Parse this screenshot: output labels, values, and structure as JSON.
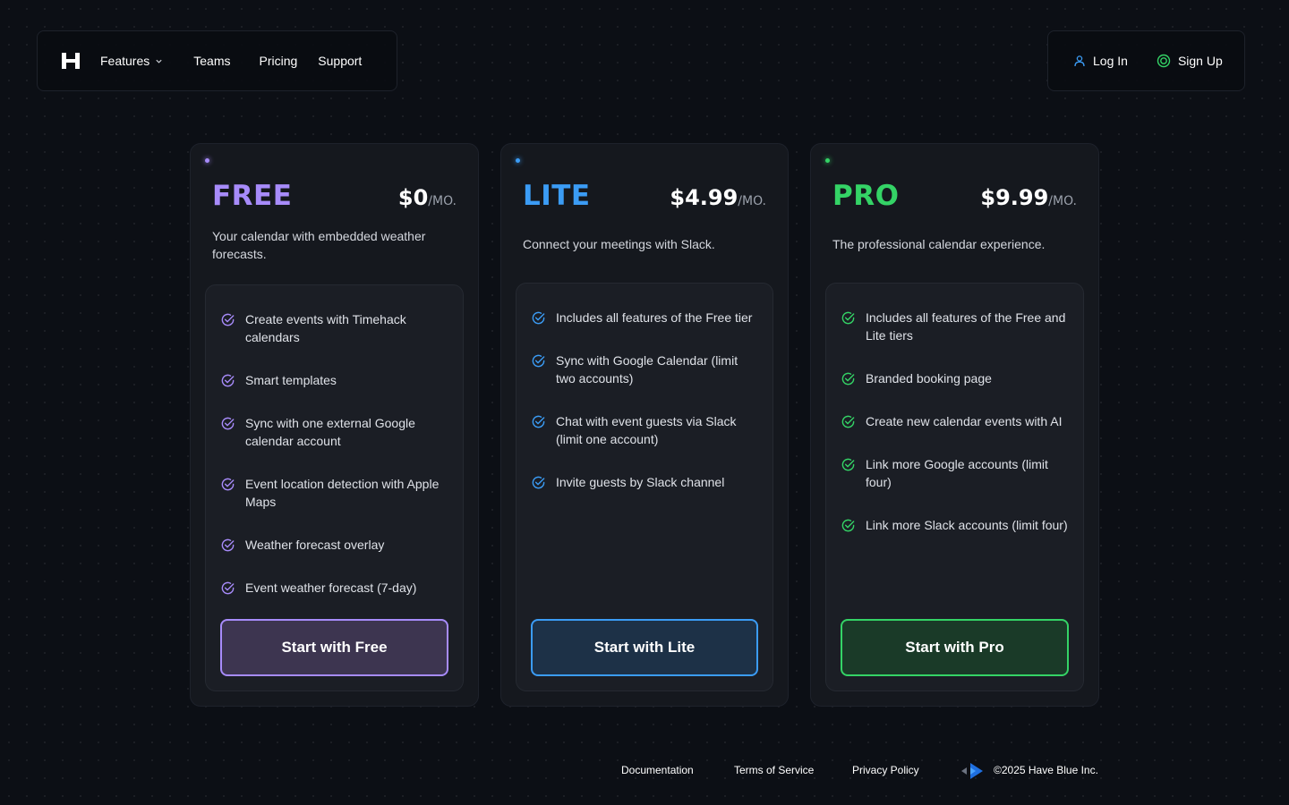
{
  "nav": {
    "logo": "logo-icon",
    "links": [
      {
        "label": "Features",
        "icon": "chevron-down-icon"
      },
      {
        "label": "Teams"
      },
      {
        "label": "Pricing"
      },
      {
        "label": "Support"
      }
    ],
    "login_label": "Log In",
    "login_icon": "user-icon",
    "signup_label": "Sign Up",
    "signup_icon": "smile-icon"
  },
  "plans": [
    {
      "name": "FREE",
      "price": "$0",
      "unit": "/MO.",
      "accent": "#a78bfa",
      "description": "Your calendar with embedded weather forecasts.",
      "features": [
        "Create events with Timehack calendars",
        "Smart templates",
        "Sync with one external Google calendar account",
        "Event location detection with Apple Maps",
        "Weather forecast overlay",
        "Event weather forecast (7-day)"
      ],
      "cta": "Start with Free"
    },
    {
      "name": "LITE",
      "price": "$4.99",
      "unit": "/MO.",
      "accent": "#3b9cf5",
      "description": "Connect your meetings with Slack.",
      "features": [
        "Includes all features of the Free tier",
        "Sync with Google Calendar (limit two accounts)",
        "Chat with event guests via Slack (limit one account)",
        "Invite guests by Slack channel"
      ],
      "cta": "Start with Lite"
    },
    {
      "name": "PRO",
      "price": "$9.99",
      "unit": "/MO.",
      "accent": "#34d366",
      "description": "The professional calendar experience.",
      "features": [
        "Includes all features of the Free and Lite tiers",
        "Branded booking page",
        "Create new calendar events with AI",
        "Link more Google accounts (limit four)",
        "Link more Slack accounts (limit four)"
      ],
      "cta": "Start with Pro"
    }
  ],
  "footer": {
    "links": [
      "Documentation",
      "Terms of Service",
      "Privacy Policy"
    ],
    "company_logo": "have-blue-logo-icon",
    "copyright": "©2025 Have Blue Inc."
  }
}
